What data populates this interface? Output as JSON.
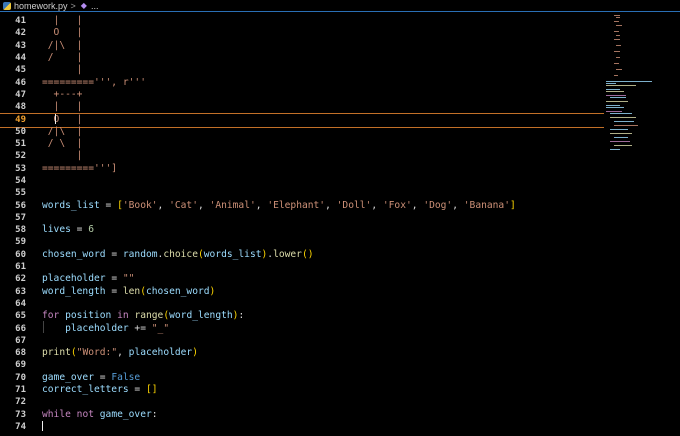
{
  "breadcrumb": {
    "file": "homework.py",
    "separator": ">",
    "ellipsis": "..."
  },
  "active_line": 49,
  "lines": [
    {
      "n": 41,
      "tokens": [
        {
          "t": "  |   |",
          "c": "str"
        }
      ]
    },
    {
      "n": 42,
      "tokens": [
        {
          "t": "  O   |",
          "c": "str"
        }
      ]
    },
    {
      "n": 43,
      "tokens": [
        {
          "t": " /|\\  |",
          "c": "str"
        }
      ]
    },
    {
      "n": 44,
      "tokens": [
        {
          "t": " /    |",
          "c": "str"
        }
      ]
    },
    {
      "n": 45,
      "tokens": [
        {
          "t": "      |",
          "c": "str"
        }
      ]
    },
    {
      "n": 46,
      "tokens": [
        {
          "t": "=========''', r'''",
          "c": "str"
        }
      ]
    },
    {
      "n": 47,
      "tokens": [
        {
          "t": "  +---+",
          "c": "str"
        }
      ]
    },
    {
      "n": 48,
      "tokens": [
        {
          "t": "  |   |",
          "c": "str"
        }
      ]
    },
    {
      "n": 49,
      "tokens": [
        {
          "t": "  O   |",
          "c": "str"
        }
      ]
    },
    {
      "n": 50,
      "tokens": [
        {
          "t": " /|\\  |",
          "c": "str"
        }
      ]
    },
    {
      "n": 51,
      "tokens": [
        {
          "t": " / \\  |",
          "c": "str"
        }
      ]
    },
    {
      "n": 52,
      "tokens": [
        {
          "t": "      |",
          "c": "str"
        }
      ]
    },
    {
      "n": 53,
      "tokens": [
        {
          "t": "=========''']",
          "c": "str"
        }
      ]
    },
    {
      "n": 54,
      "tokens": [
        {
          "t": "",
          "c": "plain"
        }
      ]
    },
    {
      "n": 55,
      "tokens": [
        {
          "t": "",
          "c": "plain"
        }
      ]
    },
    {
      "n": 56,
      "tokens": [
        {
          "t": "words_list",
          "c": "var"
        },
        {
          "t": " = ",
          "c": "plain"
        },
        {
          "t": "[",
          "c": "br1"
        },
        {
          "t": "'Book'",
          "c": "str"
        },
        {
          "t": ", ",
          "c": "plain"
        },
        {
          "t": "'Cat'",
          "c": "str"
        },
        {
          "t": ", ",
          "c": "plain"
        },
        {
          "t": "'Animal'",
          "c": "str"
        },
        {
          "t": ", ",
          "c": "plain"
        },
        {
          "t": "'Elephant'",
          "c": "str"
        },
        {
          "t": ", ",
          "c": "plain"
        },
        {
          "t": "'Doll'",
          "c": "str"
        },
        {
          "t": ", ",
          "c": "plain"
        },
        {
          "t": "'Fox'",
          "c": "str"
        },
        {
          "t": ", ",
          "c": "plain"
        },
        {
          "t": "'Dog'",
          "c": "str"
        },
        {
          "t": ", ",
          "c": "plain"
        },
        {
          "t": "'Banana'",
          "c": "str"
        },
        {
          "t": "]",
          "c": "br1"
        }
      ]
    },
    {
      "n": 57,
      "tokens": [
        {
          "t": "",
          "c": "plain"
        }
      ]
    },
    {
      "n": 58,
      "tokens": [
        {
          "t": "lives",
          "c": "var"
        },
        {
          "t": " = ",
          "c": "plain"
        },
        {
          "t": "6",
          "c": "num"
        }
      ]
    },
    {
      "n": 59,
      "tokens": [
        {
          "t": "",
          "c": "plain"
        }
      ]
    },
    {
      "n": 60,
      "tokens": [
        {
          "t": "chosen_word",
          "c": "var"
        },
        {
          "t": " = ",
          "c": "plain"
        },
        {
          "t": "random",
          "c": "var"
        },
        {
          "t": ".",
          "c": "plain"
        },
        {
          "t": "choice",
          "c": "fn"
        },
        {
          "t": "(",
          "c": "br1"
        },
        {
          "t": "words_list",
          "c": "var"
        },
        {
          "t": ")",
          "c": "br1"
        },
        {
          "t": ".",
          "c": "plain"
        },
        {
          "t": "lower",
          "c": "fn"
        },
        {
          "t": "()",
          "c": "br1"
        }
      ]
    },
    {
      "n": 61,
      "tokens": [
        {
          "t": "",
          "c": "plain"
        }
      ]
    },
    {
      "n": 62,
      "tokens": [
        {
          "t": "placeholder",
          "c": "var"
        },
        {
          "t": " = ",
          "c": "plain"
        },
        {
          "t": "\"\"",
          "c": "str"
        }
      ]
    },
    {
      "n": 63,
      "tokens": [
        {
          "t": "word_length",
          "c": "var"
        },
        {
          "t": " = ",
          "c": "plain"
        },
        {
          "t": "len",
          "c": "fn"
        },
        {
          "t": "(",
          "c": "br1"
        },
        {
          "t": "chosen_word",
          "c": "var"
        },
        {
          "t": ")",
          "c": "br1"
        }
      ]
    },
    {
      "n": 64,
      "tokens": [
        {
          "t": "",
          "c": "plain"
        }
      ]
    },
    {
      "n": 65,
      "tokens": [
        {
          "t": "for",
          "c": "kw"
        },
        {
          "t": " ",
          "c": "plain"
        },
        {
          "t": "position",
          "c": "var"
        },
        {
          "t": " ",
          "c": "plain"
        },
        {
          "t": "in",
          "c": "kw"
        },
        {
          "t": " ",
          "c": "plain"
        },
        {
          "t": "range",
          "c": "fn"
        },
        {
          "t": "(",
          "c": "br1"
        },
        {
          "t": "word_length",
          "c": "var"
        },
        {
          "t": ")",
          "c": "br1"
        },
        {
          "t": ":",
          "c": "plain"
        }
      ]
    },
    {
      "n": 66,
      "tokens": [
        {
          "t": "    ",
          "c": "plain"
        },
        {
          "t": "placeholder",
          "c": "var"
        },
        {
          "t": " += ",
          "c": "plain"
        },
        {
          "t": "\"_\"",
          "c": "str"
        }
      ]
    },
    {
      "n": 67,
      "tokens": [
        {
          "t": "",
          "c": "plain"
        }
      ]
    },
    {
      "n": 68,
      "tokens": [
        {
          "t": "print",
          "c": "fn"
        },
        {
          "t": "(",
          "c": "br1"
        },
        {
          "t": "\"Word:\"",
          "c": "str"
        },
        {
          "t": ", ",
          "c": "plain"
        },
        {
          "t": "placeholder",
          "c": "var"
        },
        {
          "t": ")",
          "c": "br1"
        }
      ]
    },
    {
      "n": 69,
      "tokens": [
        {
          "t": "",
          "c": "plain"
        }
      ]
    },
    {
      "n": 70,
      "tokens": [
        {
          "t": "game_over",
          "c": "var"
        },
        {
          "t": " = ",
          "c": "plain"
        },
        {
          "t": "False",
          "c": "bl"
        }
      ]
    },
    {
      "n": 71,
      "tokens": [
        {
          "t": "correct_letters",
          "c": "var"
        },
        {
          "t": " = ",
          "c": "plain"
        },
        {
          "t": "[]",
          "c": "br1"
        }
      ]
    },
    {
      "n": 72,
      "tokens": [
        {
          "t": "",
          "c": "plain"
        }
      ]
    },
    {
      "n": 73,
      "tokens": [
        {
          "t": "while",
          "c": "kw"
        },
        {
          "t": " ",
          "c": "plain"
        },
        {
          "t": "not",
          "c": "kw"
        },
        {
          "t": " ",
          "c": "plain"
        },
        {
          "t": "game_over",
          "c": "var"
        },
        {
          "t": ":",
          "c": "plain"
        }
      ]
    },
    {
      "n": 74,
      "tokens": [
        {
          "t": "",
          "c": "plain"
        }
      ]
    }
  ],
  "colors": {
    "accent": "#2a6fb5",
    "active_line_border": "#c27028",
    "string": "#ce9178",
    "keyword": "#c586c0"
  }
}
